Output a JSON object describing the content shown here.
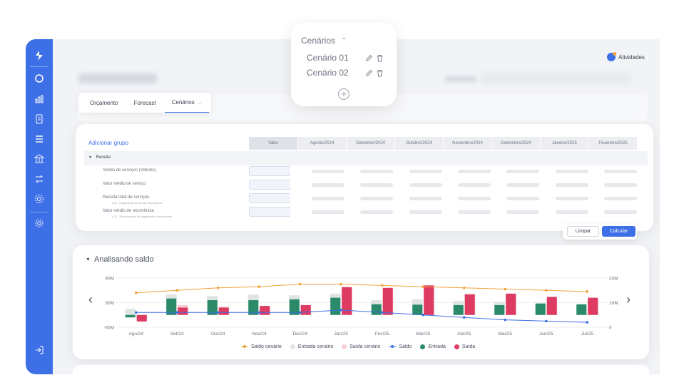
{
  "header": {
    "actividades_label": "Atividades"
  },
  "tabs": [
    {
      "label": "Orçamento"
    },
    {
      "label": "Forecast"
    },
    {
      "label": "Cenários"
    }
  ],
  "scenario_menu": {
    "title": "Cenários",
    "items": [
      {
        "label": "Cenário 01"
      },
      {
        "label": "Cenário 02"
      }
    ]
  },
  "grid": {
    "add_group": "Adicionar grupo",
    "columns": [
      "Valor",
      "Agosto/2024",
      "Setembro/2024",
      "Outubro/2024",
      "Novembro/2024",
      "Dezembro/2024",
      "Janeiro/2025",
      "Fevereiro/2025"
    ],
    "group": "Receita",
    "rows": [
      {
        "label": "Venda de serviços (Volume)",
        "sub": ""
      },
      {
        "label": "Valor médio de serviço",
        "sub": ""
      },
      {
        "label": "Receita total de serviços",
        "sub": "1.01 - Pagamento de venda de produtos"
      },
      {
        "label": "Valor médio de recorrência",
        "sub": "1.02 - Recebimento de pagamentos recorrentes"
      }
    ],
    "limpar": "Limpar",
    "calcular": "Calcular"
  },
  "analysis": {
    "title": "Analisando saldo",
    "left_axis": [
      "90M",
      "30M",
      "-30M"
    ],
    "right_axis": [
      "20M",
      "10M",
      "0"
    ],
    "prev_arrow": "‹",
    "next_arrow": "›"
  },
  "chart_data": {
    "type": "bar",
    "categories": [
      "Ago/24",
      "Set/24",
      "Out/24",
      "Nov/24",
      "Dez/24",
      "Jan/25",
      "Fev/25",
      "Mar/25",
      "Abr/25",
      "Mai/25",
      "Jun/25",
      "Jul/25"
    ],
    "ylim_left": [
      -30,
      90
    ],
    "ylim_right": [
      0,
      20
    ],
    "series": [
      {
        "name": "Saldo cenário",
        "type": "line",
        "axis": "right",
        "color": "#f2a23a",
        "values": [
          14,
          15,
          16,
          16.5,
          17.5,
          17.5,
          17,
          16.5,
          16,
          15.5,
          15,
          14.5
        ]
      },
      {
        "name": "Entrada cenário",
        "type": "bar",
        "axis": "left",
        "color": "#dfe5e3",
        "values": [
          15,
          50,
          46,
          50,
          48,
          52,
          36,
          38,
          34,
          32,
          22,
          20
        ]
      },
      {
        "name": "Saída cenário",
        "type": "bar",
        "axis": "left",
        "color": "#f6cfd6",
        "values": [
          -10,
          24,
          20,
          22,
          22,
          62,
          62,
          72,
          52,
          48,
          40,
          38
        ]
      },
      {
        "name": "Saldo",
        "type": "line",
        "axis": "right",
        "color": "#3d6fe6",
        "values": [
          6,
          6,
          6,
          6,
          6,
          7,
          6,
          5,
          4,
          3,
          2.5,
          2
        ]
      },
      {
        "name": "Entrada",
        "type": "bar",
        "axis": "left",
        "color": "#2a8a6a",
        "values": [
          -6,
          40,
          36,
          36,
          38,
          42,
          26,
          25,
          24,
          24,
          28,
          26
        ]
      },
      {
        "name": "Saída",
        "type": "bar",
        "axis": "left",
        "color": "#de3b62",
        "values": [
          -16,
          18,
          18,
          22,
          24,
          68,
          66,
          72,
          50,
          52,
          44,
          42
        ]
      }
    ]
  }
}
